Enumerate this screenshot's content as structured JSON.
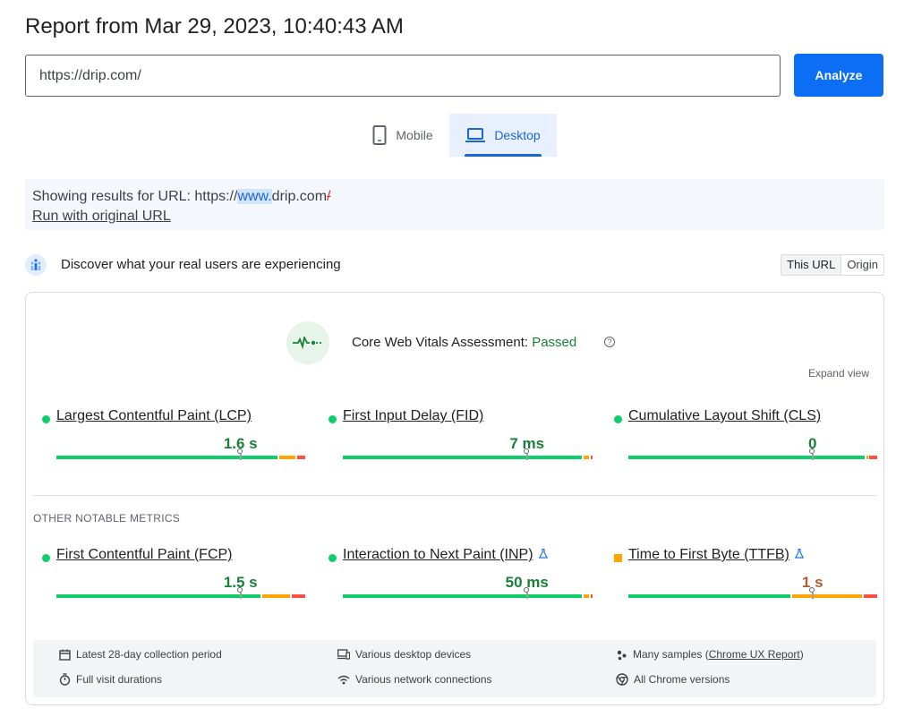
{
  "report": {
    "title": "Report from Mar 29, 2023, 10:40:43 AM"
  },
  "search": {
    "value": "https://drip.com/",
    "analyze_label": "Analyze"
  },
  "tabs": {
    "mobile": "Mobile",
    "desktop": "Desktop",
    "active": "desktop"
  },
  "notice": {
    "prefix": "Showing results for URL: https://",
    "highlight": "www.",
    "domain": "drip.com",
    "strike": "/",
    "run_link": "Run with original URL"
  },
  "crux": {
    "title": "Discover what your real users are experiencing",
    "toggle_this_url": "This URL",
    "toggle_origin": "Origin",
    "assessment_label": "Core Web Vitals Assessment: ",
    "assessment_status": "Passed",
    "help": "?",
    "expand": "Expand view",
    "other_title": "OTHER NOTABLE METRICS",
    "colors": {
      "good": "#0cce6b",
      "needs_improvement": "#ffa400",
      "poor": "#ff4e42",
      "passed": "#188038"
    }
  },
  "core_metrics": [
    {
      "name": "Largest Contentful Paint (LCP)",
      "value": "1.6 s",
      "rating": "good",
      "distribution": [
        0.89,
        0.07,
        0.04
      ],
      "marker": 0.74
    },
    {
      "name": "First Input Delay (FID)",
      "value": "7 ms",
      "rating": "good",
      "distribution": [
        0.96,
        0.03,
        0.01
      ],
      "marker": 0.74
    },
    {
      "name": "Cumulative Layout Shift (CLS)",
      "value": "0",
      "rating": "good",
      "distribution": [
        0.95,
        0.01,
        0.04
      ],
      "marker": 0.74
    }
  ],
  "other_metrics": [
    {
      "name": "First Contentful Paint (FCP)",
      "value": "1.5 s",
      "rating": "good",
      "distribution": [
        0.82,
        0.12,
        0.06
      ],
      "marker": 0.74,
      "experimental": false
    },
    {
      "name": "Interaction to Next Paint (INP)",
      "value": "50 ms",
      "rating": "good",
      "distribution": [
        0.96,
        0.03,
        0.01
      ],
      "marker": 0.74,
      "experimental": true
    },
    {
      "name": "Time to First Byte (TTFB)",
      "value": "1 s",
      "rating": "needs_improvement",
      "distribution": [
        0.65,
        0.29,
        0.06
      ],
      "marker": 0.74,
      "experimental": true
    }
  ],
  "footer": {
    "collection": "Latest 28-day collection period",
    "devices": "Various desktop devices",
    "samples_prefix": "Many samples (",
    "samples_link": "Chrome UX Report",
    "samples_suffix": ")",
    "durations": "Full visit durations",
    "network": "Various network connections",
    "chrome": "All Chrome versions"
  }
}
